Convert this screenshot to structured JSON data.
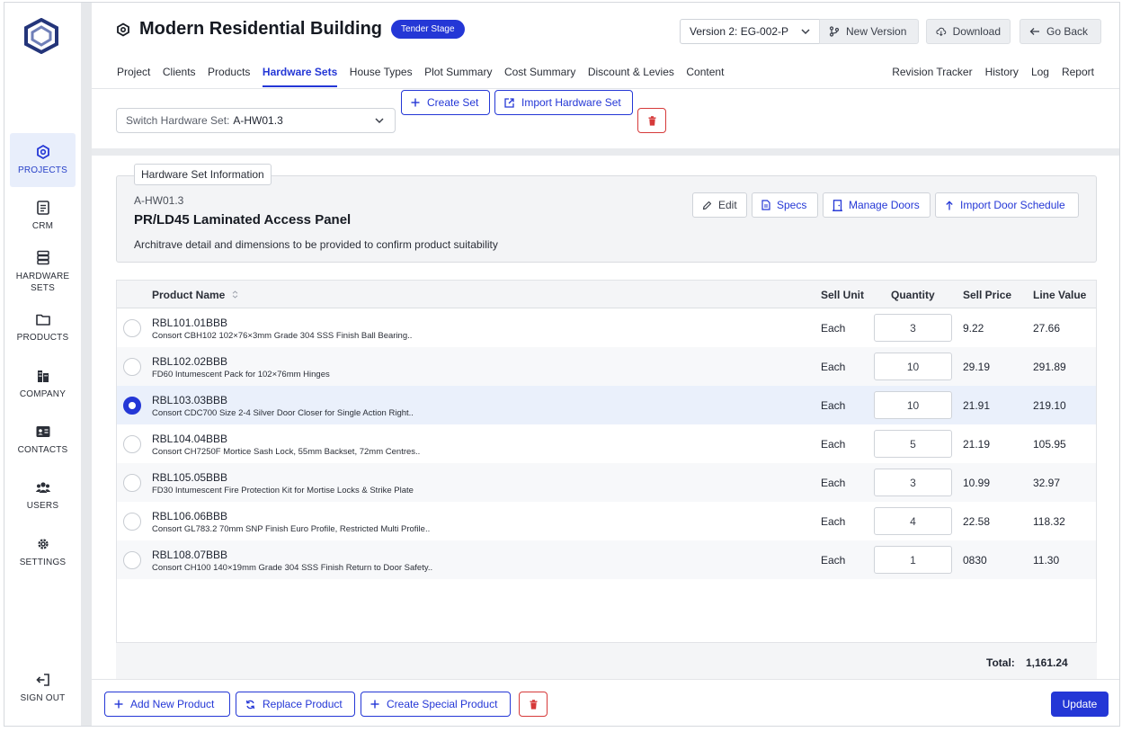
{
  "sidebar": {
    "items": [
      {
        "label": "PROJECTS",
        "icon": "projects-icon",
        "active": true
      },
      {
        "label": "CRM",
        "icon": "crm-icon"
      },
      {
        "label": "HARDWARE SETS",
        "icon": "hardware-sets-icon"
      },
      {
        "label": "PRODUCTS",
        "icon": "folder-icon"
      },
      {
        "label": "COMPANY",
        "icon": "building-icon"
      },
      {
        "label": "CONTACTS",
        "icon": "contact-card-icon"
      },
      {
        "label": "USERS",
        "icon": "users-icon"
      },
      {
        "label": "SETTINGS",
        "icon": "gear-icon"
      }
    ],
    "sign_out": "SIGN OUT"
  },
  "header": {
    "title": "Modern Residential Building",
    "stage_badge": "Tender Stage",
    "version_select": "Version 2: EG-002-P",
    "new_version": "New Version",
    "download": "Download",
    "go_back": "Go Back",
    "tabs": [
      "Project",
      "Clients",
      "Products",
      "Hardware Sets",
      "House Types",
      "Plot Summary",
      "Cost Summary",
      "Discount & Levies",
      "Content"
    ],
    "active_tab": "Hardware Sets",
    "right_tabs": [
      "Revision Tracker",
      "History",
      "Log",
      "Report"
    ]
  },
  "toolbar": {
    "switch_label": "Switch Hardware Set:",
    "switch_value": "A-HW01.3",
    "create_set": "Create Set",
    "import_set": "Import Hardware Set"
  },
  "info": {
    "legend": "Hardware Set Information",
    "code": "A-HW01.3",
    "name": "PR/LD45 Laminated Access Panel",
    "note": "Architrave detail and dimensions to be provided to confirm product suitability",
    "edit": "Edit",
    "specs": "Specs",
    "manage_doors": "Manage Doors",
    "import_door_schedule": "Import Door Schedule"
  },
  "table": {
    "headers": {
      "product_name": "Product Name",
      "sell_unit": "Sell Unit",
      "quantity": "Quantity",
      "sell_price": "Sell Price",
      "line_value": "Line Value"
    },
    "rows": [
      {
        "code": "RBL101.01BBB",
        "desc": "Consort CBH102 102×76×3mm Grade 304 SSS Finish Ball Bearing..",
        "unit": "Each",
        "qty": "3",
        "price": "9.22",
        "value": "27.66",
        "selected": false
      },
      {
        "code": "RBL102.02BBB",
        "desc": "FD60 Intumescent Pack for 102×76mm Hinges",
        "unit": "Each",
        "qty": "10",
        "price": "29.19",
        "value": "291.89",
        "selected": false
      },
      {
        "code": "RBL103.03BBB",
        "desc": "Consort CDC700 Size 2-4 Silver Door Closer for Single Action Right..",
        "unit": "Each",
        "qty": "10",
        "price": "21.91",
        "value": "219.10",
        "selected": true
      },
      {
        "code": "RBL104.04BBB",
        "desc": "Consort CH7250F Mortice Sash Lock, 55mm Backset, 72mm Centres..",
        "unit": "Each",
        "qty": "5",
        "price": "21.19",
        "value": "105.95",
        "selected": false
      },
      {
        "code": "RBL105.05BBB",
        "desc": "FD30 Intumescent Fire Protection Kit for Mortise Locks & Strike Plate",
        "unit": "Each",
        "qty": "3",
        "price": "10.99",
        "value": "32.97",
        "selected": false
      },
      {
        "code": "RBL106.06BBB",
        "desc": "Consort GL783.2 70mm SNP Finish Euro Profile, Restricted Multi Profile..",
        "unit": "Each",
        "qty": "4",
        "price": "22.58",
        "value": "118.32",
        "selected": false
      },
      {
        "code": "RBL108.07BBB",
        "desc": "Consort CH100 140×19mm Grade 304 SSS Finish Return to Door Safety..",
        "unit": "Each",
        "qty": "1",
        "price": "0830",
        "value": "11.30",
        "selected": false
      }
    ],
    "total_label": "Total:",
    "total_value": "1,161.24"
  },
  "footer": {
    "add_new_product": "Add New Product",
    "replace_product": "Replace Product",
    "create_special_product": "Create Special Product",
    "update": "Update"
  },
  "colors": {
    "accent": "#2437d6",
    "danger": "#d63a3a",
    "selected_row": "#eaf0fb"
  }
}
